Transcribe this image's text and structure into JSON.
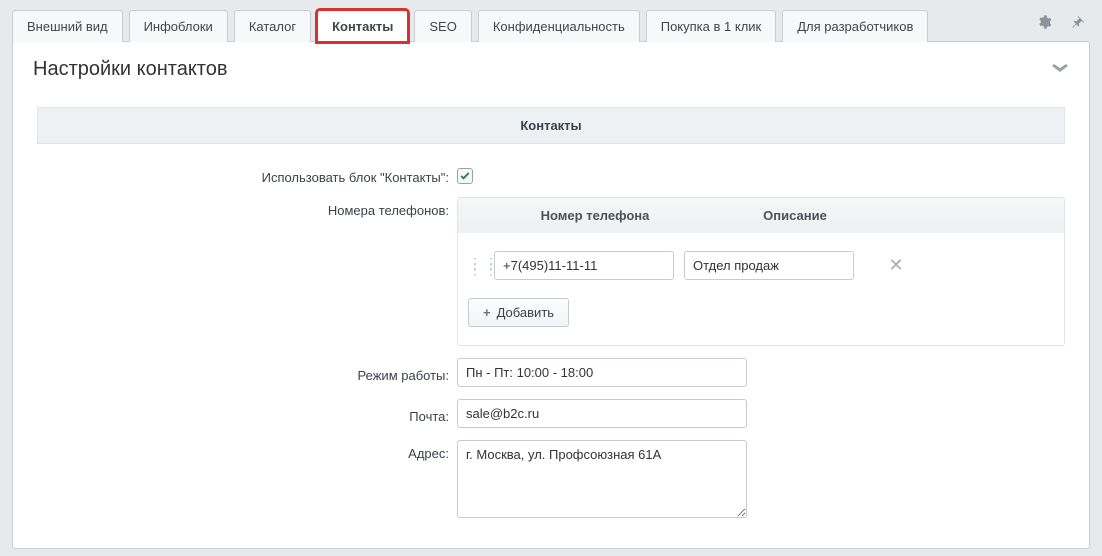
{
  "tabs": [
    {
      "label": "Внешний вид"
    },
    {
      "label": "Инфоблоки"
    },
    {
      "label": "Каталог"
    },
    {
      "label": "Контакты",
      "active": true
    },
    {
      "label": "SEO"
    },
    {
      "label": "Конфиденциальность"
    },
    {
      "label": "Покупка в 1 клик"
    },
    {
      "label": "Для разработчиков"
    }
  ],
  "panel": {
    "title": "Настройки контактов"
  },
  "section": {
    "header": "Контакты"
  },
  "fields": {
    "use_block_label": "Использовать блок \"Контакты\":",
    "use_block_checked": true,
    "phones_label": "Номера телефонов:",
    "phones_header_phone": "Номер телефона",
    "phones_header_desc": "Описание",
    "phone_rows": [
      {
        "phone": "+7(495)11-11-11",
        "desc": "Отдел продаж"
      }
    ],
    "add_button": "Добавить",
    "schedule_label": "Режим работы:",
    "schedule_value": "Пн - Пт: 10:00 - 18:00",
    "email_label": "Почта:",
    "email_value": "sale@b2c.ru",
    "address_label": "Адрес:",
    "address_value": "г. Москва, ул. Профсоюзная 61А"
  }
}
